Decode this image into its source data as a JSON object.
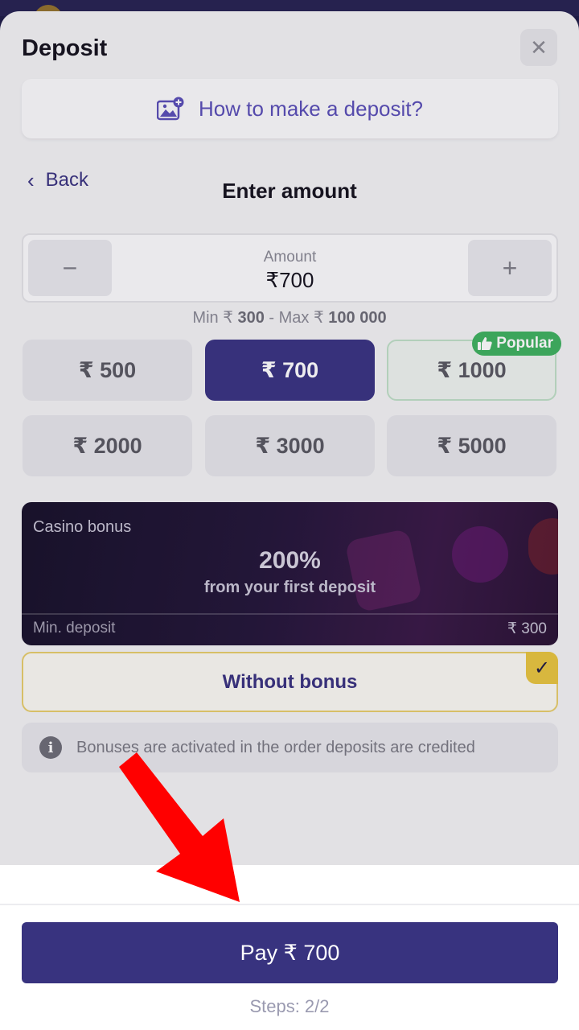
{
  "modal": {
    "title": "Deposit",
    "close_icon": "close-icon",
    "howto_label": "How to make a deposit?",
    "howto_icon": "image-plus-icon"
  },
  "nav": {
    "back_label": "Back",
    "step_title": "Enter amount"
  },
  "amount": {
    "label": "Amount",
    "value": "₹700",
    "minus": "−",
    "plus": "+",
    "limits_prefix_min": "Min ₹",
    "min": "300",
    "limits_prefix_max": " - Max ₹",
    "max": "100 000"
  },
  "presets": [
    {
      "label": "₹ 500"
    },
    {
      "label": "₹ 700"
    },
    {
      "label": "₹ 1000"
    },
    {
      "label": "₹ 2000"
    },
    {
      "label": "₹ 3000"
    },
    {
      "label": "₹ 5000"
    }
  ],
  "popular_badge": "Popular",
  "bonus": {
    "name": "Casino bonus",
    "percent": "200%",
    "subtitle": "from your first deposit",
    "min_label": "Min. deposit",
    "min_value": "₹ 300"
  },
  "no_bonus_label": "Without bonus",
  "info_text": "Bonuses are activated in the order deposits are credited",
  "footer": {
    "pay_label": "Pay ₹ 700",
    "steps": "Steps: 2/2"
  },
  "colors": {
    "accent": "#38337f",
    "popular": "#3fb260",
    "selected_border": "#e8cf6d",
    "annotation_arrow": "#ff0000"
  }
}
